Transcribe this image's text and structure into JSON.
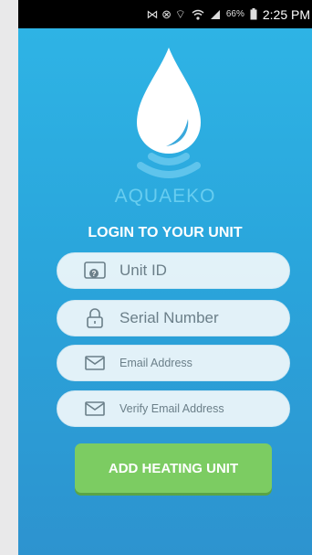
{
  "status_bar": {
    "signal_icons": "⋈ ⊗ ⌔",
    "battery_percent": "66%",
    "time": "2:25 PM"
  },
  "brand": {
    "name": "AQUAEKO"
  },
  "login": {
    "title": "LOGIN TO YOUR UNIT"
  },
  "fields": {
    "unit_id": {
      "placeholder": "Unit ID"
    },
    "serial_number": {
      "placeholder": "Serial Number"
    },
    "email": {
      "placeholder": "Email Address"
    },
    "verify_email": {
      "placeholder": "Verify Email Address"
    }
  },
  "actions": {
    "add_unit_label": "ADD HEATING UNIT"
  },
  "colors": {
    "background_top": "#2fb5e6",
    "background_bottom": "#2d93cf",
    "brand_text": "#67cdf0",
    "button": "#7ccc62"
  }
}
